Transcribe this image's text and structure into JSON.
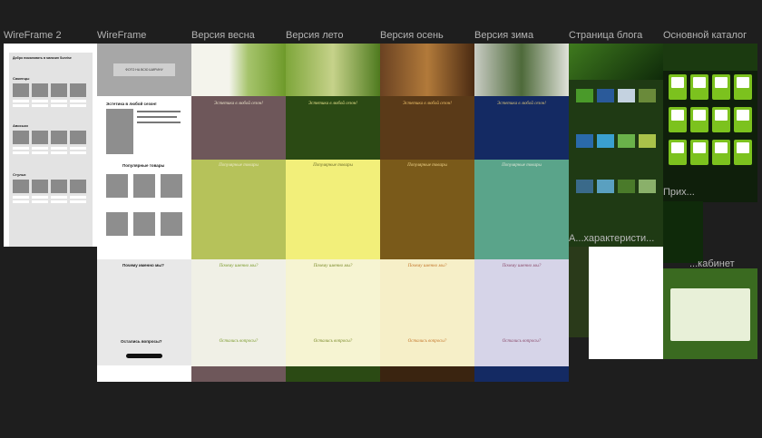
{
  "frames": {
    "wireframe2": "WireFrame 2",
    "wireframe": "WireFrame",
    "spring": "Версия весна",
    "summer": "Версия лето",
    "autumn": "Версия осень",
    "winter": "Версия зима",
    "blog": "Страница блога",
    "catalog": "Основной каталог",
    "product": "Прих...",
    "characteristics": "А...характеристи...",
    "cabinet": "...кабинет"
  },
  "wireframe2_content": {
    "heading": "Добро пожаловать в магазин Sunrise",
    "section1": "Саженцы",
    "section2": "Авоськи",
    "section3": "Стулья"
  },
  "wireframe_content": {
    "hero_text": "ФОТО НА ВСЮ ШИРИНУ",
    "aesthetics": "Эстетика в любой сезон!",
    "popular": "Популярные товары",
    "why": "Почему именно мы?",
    "questions": "Остались вопросы?"
  },
  "season_titles": {
    "aesthetics": "Эстетика в любой сезон!",
    "popular": "Популярные товары",
    "why": "Почему именно мы?",
    "questions": "Остались вопросы?"
  },
  "colors": {
    "canvas": "#1e1e1e",
    "label": "#b3b3b3",
    "spring_mid": "#6e575a",
    "summer_mid": "#2b4a14",
    "autumn_mid": "#5a3a18",
    "winter_mid": "#142a63"
  }
}
